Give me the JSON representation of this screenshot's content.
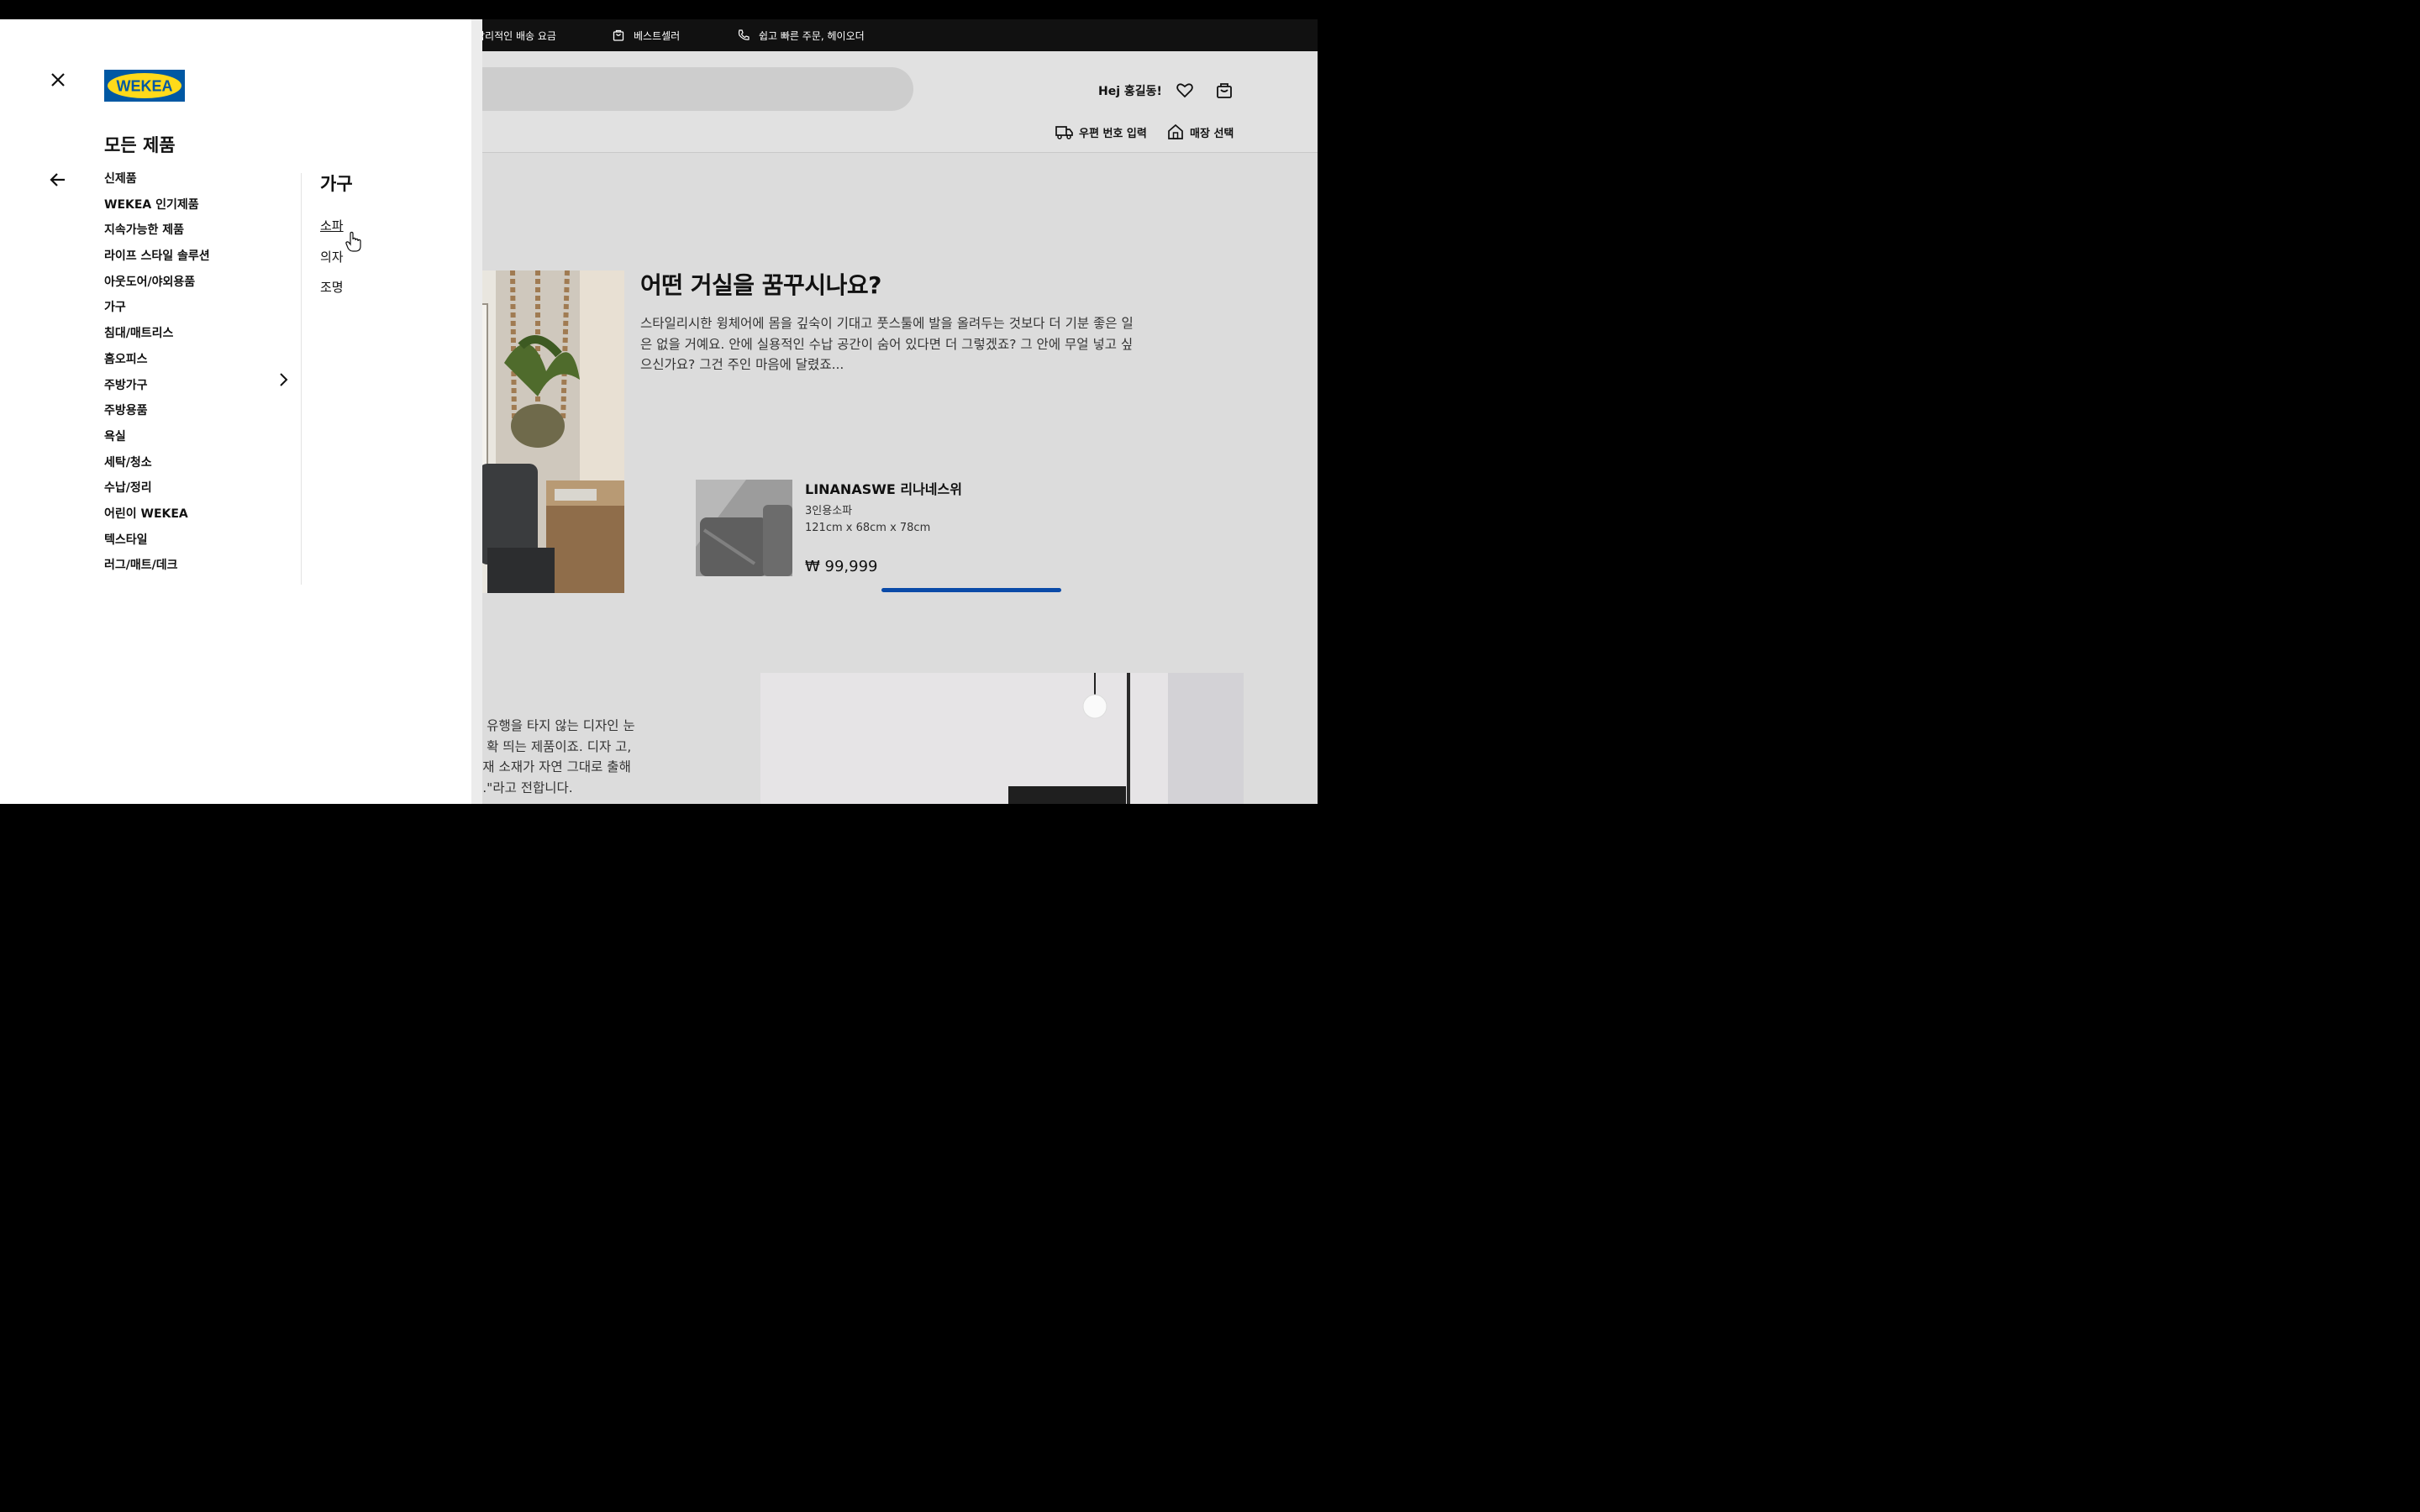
{
  "topbar": {
    "items": [
      {
        "label": "합리적인 배송 요금",
        "icon": "truck-icon"
      },
      {
        "label": "베스트셀러",
        "icon": "shopping-bag-icon"
      },
      {
        "label": "쉽고 빠른 주문, 헤이오더",
        "icon": "phone-icon"
      }
    ]
  },
  "header": {
    "greeting": "Hej 홍길동!",
    "postcode_label": "우편 번호 입력",
    "store_label": "매장 선택"
  },
  "hero": {
    "headline": "어떤 거실을 꿈꾸시나요?",
    "paragraph": "스타일리시한 윙체어에 몸을 깊숙이 기대고 풋스툴에 발을 올려두는 것보다 더 기분 좋은 일은 없을 거예요. 안에 실용적인 수납 공간이 숨어 있다면 더 그렇겠죠? 그 안에 무얼 넣고 싶으신가요? 그건 주인 마음에 달렸죠..."
  },
  "product": {
    "name": "LINANASWE 리나네스위",
    "desc": "3인용소파",
    "dimensions": "121cm x 68cm x 78cm",
    "price": "₩ 99,999"
  },
  "lower_text": "여 유행을 타지 않는 디자인 눈에 확 띄는 제품이죠. 디자 고, 목재 소재가 자연 그대로 출해요.\"라고 전합니다.",
  "drawer": {
    "logo_text": "WEKEA",
    "title": "모든 제품",
    "categories": [
      "신제품",
      "WEKEA 인기제품",
      "지속가능한 제품",
      "라이프 스타일 솔루션",
      "아웃도어/야외용품",
      "가구",
      "침대/매트리스",
      "홈오피스",
      "주방가구",
      "주방용품",
      "욕실",
      "세탁/청소",
      "수납/정리",
      "어린이 WEKEA",
      "텍스타일",
      "러그/매트/데크"
    ],
    "subcategory_title": "가구",
    "subcategories": [
      "소파",
      "의자",
      "조명"
    ]
  },
  "colors": {
    "brand_blue": "#0058a3",
    "brand_yellow": "#ffda1a",
    "progress_blue": "#0a4aa8"
  }
}
